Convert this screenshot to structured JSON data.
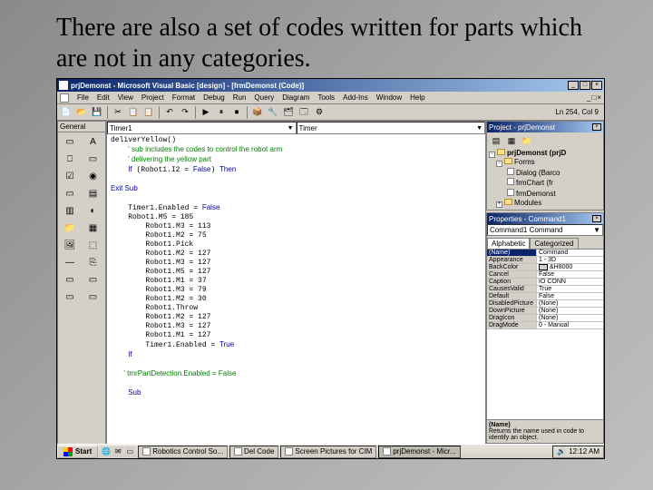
{
  "slide": {
    "caption": "There are also a set of codes written for parts which are not in any categories."
  },
  "window": {
    "title": "prjDemonst - Microsoft Visual Basic [design] - [frmDemonst (Code)]",
    "min": "_",
    "max": "□",
    "close": "×"
  },
  "inner_window": {
    "min": "_",
    "max": "□",
    "close": "×"
  },
  "menu": {
    "file": "File",
    "edit": "Edit",
    "view": "View",
    "project": "Project",
    "format": "Format",
    "debug": "Debug",
    "run": "Run",
    "query": "Query",
    "diagram": "Diagram",
    "tools": "Tools",
    "addins": "Add-Ins",
    "window": "Window",
    "help": "Help"
  },
  "toolbar": {
    "icons": [
      "📄",
      "📂",
      "💾",
      "|",
      "✂",
      "📋",
      "📋",
      "|",
      "↶",
      "↷",
      "|",
      "▶",
      "⏸",
      "⏹",
      "|",
      "📦",
      "🔧",
      "🗂",
      "🗔",
      "⚙",
      "|"
    ],
    "status": "Ln 254, Col 9"
  },
  "toolbox": {
    "title": "General",
    "tools": [
      "▭",
      "A",
      "⎕",
      "▭",
      "☑",
      "◉",
      "▭",
      "▤",
      "▥",
      "◐",
      "📁",
      "▦",
      "🖼",
      "⬚",
      "—",
      "⎘",
      "▭",
      "▭",
      "▭",
      "▭"
    ]
  },
  "code": {
    "left_dropdown": "Timer1",
    "right_dropdown": "Timer",
    "lines_html": "deliverYellow()\n    <span class='comment'>' sub includes the codes to control the robot arm</span>\n    <span class='comment'>' delivering the yellow part</span>\n    <span class='keyword'>If</span> (Robot1.I2 = <span class='keyword'>False</span>) <span class='keyword'>Then</span>\n\n<span class='keyword'>Exit Sub</span>\n\n    Timer1.Enabled = <span class='keyword'>False</span>\n    Robot1.M5 = 185\n        Robot1.M3 = 113\n        Robot1.M2 = 75\n        Robot1.Pick\n        Robot1.M2 = 127\n        Robot1.M3 = 127\n        Robot1.M5 = 127\n        Robot1.M1 = 37\n        Robot1.M3 = 79\n        Robot1.M2 = 30\n        Robot1.Throw\n        Robot1.M2 = 127\n        Robot1.M3 = 127\n        Robot1.M1 = 127\n        Timer1.Enabled = <span class='keyword'>True</span>\n    <span class='keyword'>If</span>\n\n   <span class='comment'>' tmrPartDetection.Enabled = False</span>\n\n    <span class='keyword'>Sub</span>"
  },
  "project_explorer": {
    "title": "Project - prjDemonst",
    "root": "prjDemonst (prjD",
    "forms": "Forms",
    "form1": "Dialog (Barco",
    "form2": "frmChart (fr",
    "form3": "frmDemonst",
    "modules": "Modules"
  },
  "properties": {
    "title": "Properties - Command1",
    "selector": "Command1 Command",
    "tab_alpha": "Alphabetic",
    "tab_cat": "Categorized",
    "rows": [
      {
        "name": "(Name)",
        "val": "Command"
      },
      {
        "name": "Appearance",
        "val": "1 - 3D"
      },
      {
        "name": "BackColor",
        "val": "&H8000",
        "chip": "#d4d0c8"
      },
      {
        "name": "Cancel",
        "val": "False"
      },
      {
        "name": "Caption",
        "val": "IO CONN"
      },
      {
        "name": "CausesValid",
        "val": "True"
      },
      {
        "name": "Default",
        "val": "False"
      },
      {
        "name": "DisabledPicture",
        "val": "(None)"
      },
      {
        "name": "DownPicture",
        "val": "(None)"
      },
      {
        "name": "DragIcon",
        "val": "(None)"
      },
      {
        "name": "DragMode",
        "val": "0 - Manual"
      }
    ],
    "desc_title": "(Name)",
    "desc_text": "Returns the name used in code to identify an object."
  },
  "taskbar": {
    "start": "Start",
    "tasks": [
      {
        "label": "Robotics Control So..."
      },
      {
        "label": "Del Code"
      },
      {
        "label": "Screen Pictures for CIM"
      },
      {
        "label": "prjDemonst - Micr...",
        "active": true
      }
    ],
    "time": "12:12 AM"
  }
}
